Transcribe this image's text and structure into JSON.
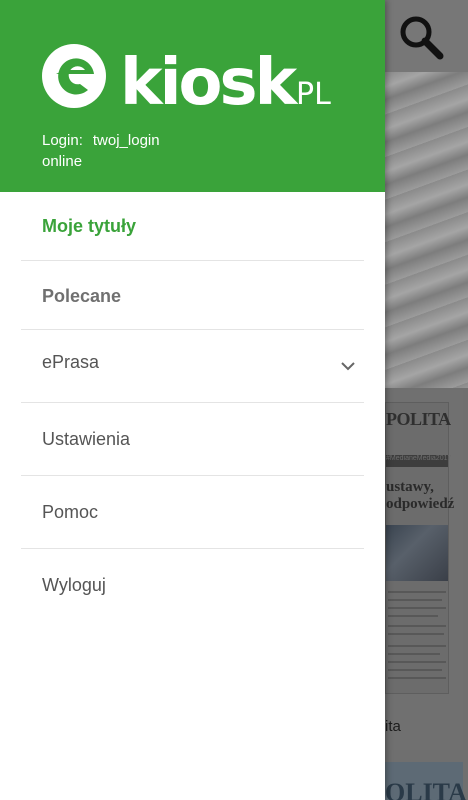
{
  "app": {
    "brand": "ekiosk.PL",
    "colors": {
      "accent": "#3aa33a",
      "header_text": "#ffffff",
      "menu_text": "#555555"
    }
  },
  "header": {
    "login_label": "Login:",
    "login_value": "twoj_login",
    "status": "online"
  },
  "menu": {
    "items": [
      {
        "label": "Moje tytuły",
        "active": true
      },
      {
        "label": "Polecane"
      },
      {
        "label": "ePrasa",
        "icon": "chevron-down-icon"
      },
      {
        "label": "Ustawienia"
      },
      {
        "label": "Pomoc"
      },
      {
        "label": "Wyloguj"
      }
    ]
  },
  "background": {
    "search_icon": "search-icon",
    "cover_masthead": "POLITA",
    "cover_tag": "#MedianeMedia2017",
    "cover_headline": "ustawy, odpowiedź",
    "cover_title": "ita",
    "next_cover_masthead": "OLITA"
  }
}
